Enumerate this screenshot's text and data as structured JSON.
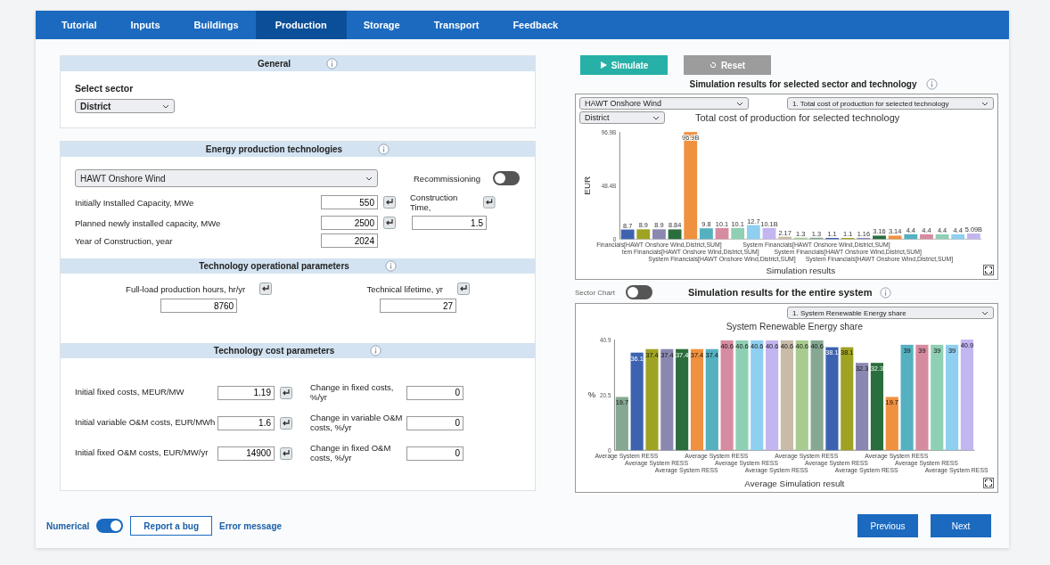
{
  "tabs": [
    {
      "label": "Tutorial",
      "selected": false
    },
    {
      "label": "Inputs",
      "selected": false
    },
    {
      "label": "Buildings",
      "selected": false
    },
    {
      "label": "Production",
      "selected": true
    },
    {
      "label": "Storage",
      "selected": false
    },
    {
      "label": "Transport",
      "selected": false
    },
    {
      "label": "Feedback",
      "selected": false
    }
  ],
  "general": {
    "title": "General",
    "sector_label": "Select sector",
    "sector": "District"
  },
  "technologies": {
    "title": "Energy production technologies",
    "technology": "HAWT Onshore Wind",
    "recommissioning_label": "Recommissioning",
    "recommissioning": false,
    "fields": [
      {
        "label": "Initially Installed Capacity, MWe",
        "value": "550"
      },
      {
        "label": "Planned newly installed capacity, MWe",
        "value": "2500"
      },
      {
        "label": "Year of Construction, year",
        "value": "2024"
      }
    ],
    "construction_time": {
      "label": "Construction Time,",
      "value": "1.5"
    }
  },
  "operational": {
    "title": "Technology operational parameters",
    "fields": [
      {
        "label": "Full-load production hours, hr/yr",
        "value": "8760"
      },
      {
        "label": "Technical lifetime, yr",
        "value": "27"
      }
    ]
  },
  "cost": {
    "title": "Technology cost parameters",
    "fields": [
      {
        "label": "Initial fixed costs, MEUR/MW",
        "value": "1.19"
      },
      {
        "label": "Initial variable O&M costs, EUR/MWh",
        "value": "1.6"
      },
      {
        "label": "Initial fixed O&M costs, EUR/MW/yr",
        "value": "14900"
      }
    ],
    "changes": [
      {
        "label": "Change in fixed costs, %/yr",
        "value": "0"
      },
      {
        "label": "Change in variable O&M costs, %/yr",
        "value": "0"
      },
      {
        "label": "Change in fixed O&M costs, %/yr",
        "value": "0"
      }
    ]
  },
  "actions": {
    "simulate": "Simulate",
    "reset": "Reset"
  },
  "sector_results": {
    "title": "Simulation results for selected sector and technology",
    "technology": "HAWT Onshore Wind",
    "sector": "District",
    "metric": "1. Total cost of production for selected technology",
    "chart_data": {
      "type": "bar",
      "title": "Total cost of production for selected technology",
      "xlabel": "Simulation results",
      "ylabel": "EUR",
      "ylim": [
        0,
        96.9
      ],
      "yticks": [
        0,
        {
          "value": 48.4,
          "label": "48.4B"
        },
        {
          "value": 96.9,
          "label": "96.9B"
        }
      ],
      "values": [
        8.7,
        8.9,
        8.9,
        8.84,
        96.9,
        9.8,
        10.1,
        10.1,
        12.7,
        10.1,
        2.17,
        1.3,
        1.3,
        1.1,
        1.1,
        1.16,
        3.16,
        3.14,
        4.4,
        4.4,
        4.4,
        4.4,
        5.09
      ],
      "value_labels": [
        "8.7",
        "8.9",
        "8.9",
        "8.84",
        "96.9B",
        "9.8",
        "10.1",
        "10.1",
        "12.7",
        "10.1B",
        "2.17",
        "1.3",
        "1.3",
        "1.1",
        "1.1",
        "1.16",
        "3.16",
        "3.14",
        "4.4",
        "4.4",
        "4.4",
        "4.4",
        "5.09B"
      ]
    },
    "axis_labels": [
      "Financials[HAWT Onshore Wind,District,SUM]",
      "tem Financials[HAWT Onshore Wind,District,SUM]",
      "System Financials[HAWT Onshore Wind,District,SUM]",
      "System Financials[HAWT Onshore Wind,District,SUM]",
      "System Financials[HAWT Onshore Wind,District,SUM]",
      "System Financials[HAWT Onshore Wind,District,SUM]"
    ]
  },
  "system_results": {
    "sector_chart_label": "Sector Chart",
    "sector_chart": false,
    "title": "Simulation results for the entire system",
    "metric": "1. System Renewable Energy share",
    "chart_data": {
      "type": "bar",
      "title": "System Renewable Energy share",
      "xlabel": "Average Simulation result",
      "ylabel": "%",
      "ylim": [
        0,
        40.9
      ],
      "yticks": [
        0,
        20.5,
        40.9
      ],
      "values": [
        19.7,
        36.1,
        37.4,
        37.4,
        37.4,
        37.4,
        37.4,
        40.6,
        40.6,
        40.6,
        40.6,
        40.6,
        40.6,
        40.6,
        38.1,
        38.1,
        32.3,
        32.3,
        19.7,
        39,
        39,
        39,
        39,
        40.9
      ],
      "value_labels": [
        "19.7",
        "36.1",
        "37.4",
        "37.4",
        "37.4",
        "37.4",
        "37.4",
        "40.6",
        "40.6",
        "40.6",
        "40.6",
        "40.6",
        "40.6",
        "40.6",
        "38.1",
        "38.1",
        "32.3",
        "32.3",
        "19.7",
        "39",
        "39",
        "39",
        "39",
        "40.9"
      ]
    },
    "axis_labels": [
      "Average System RESS",
      "Average System RESS",
      "Average System RESS",
      "Average System RESS",
      "Average System RESS",
      "Average System RESS",
      "Average System RESS",
      "Average System RESS",
      "Average System RESS",
      "Average System RESS",
      "Average System RESS",
      "Average System RESS"
    ]
  },
  "footer": {
    "numerical_label": "Numerical",
    "numerical": true,
    "report": "Report a bug",
    "error": "Error message",
    "previous": "Previous",
    "next": "Next"
  }
}
